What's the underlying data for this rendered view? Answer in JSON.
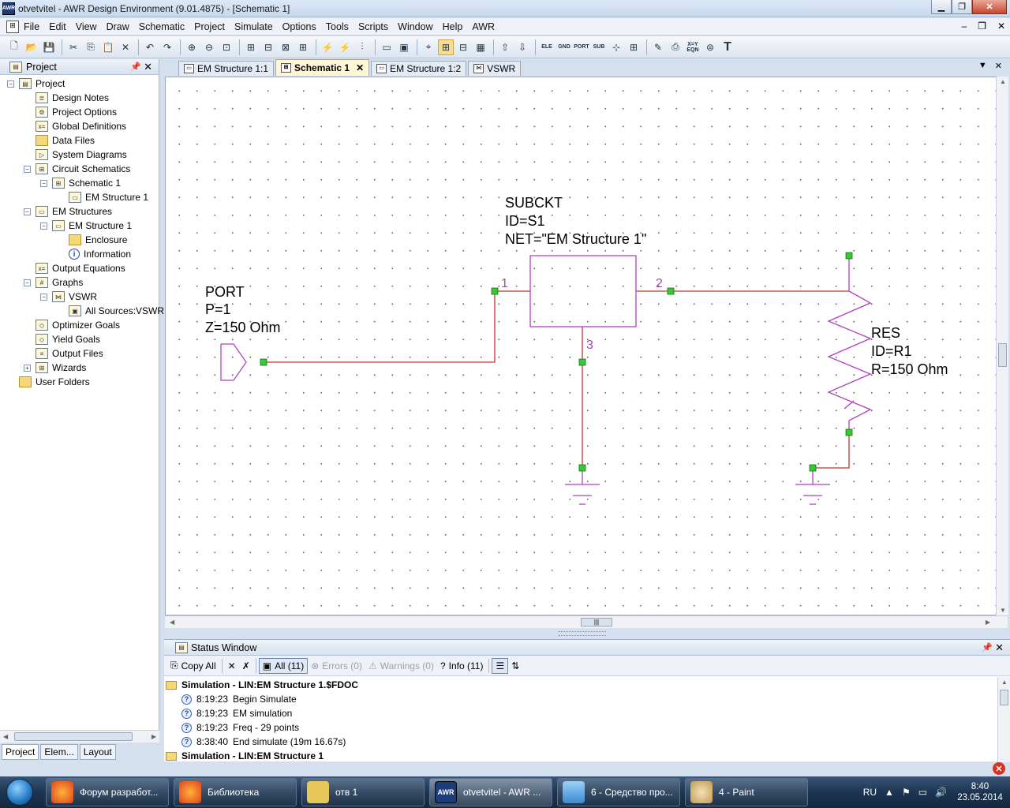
{
  "window": {
    "title": "otvetvitel - AWR Design Environment (9.01.4875) - [Schematic 1]",
    "app_icon": "AWR"
  },
  "menu": [
    "File",
    "Edit",
    "View",
    "Draw",
    "Schematic",
    "Project",
    "Simulate",
    "Options",
    "Tools",
    "Scripts",
    "Window",
    "Help",
    "AWR"
  ],
  "toolbar": {
    "labels": {
      "ele": "ELE",
      "gnd": "GND",
      "port": "PORT",
      "sub": "SUB",
      "eqn": "X=Y\nEQN",
      "text": "T"
    }
  },
  "project_panel": {
    "title": "Project",
    "tree": [
      {
        "label": "Project",
        "icon": "project-icon"
      },
      {
        "label": "Design Notes",
        "icon": "notes-icon"
      },
      {
        "label": "Project Options",
        "icon": "options-icon"
      },
      {
        "label": "Global Definitions",
        "icon": "definitions-icon"
      },
      {
        "label": "Data Files",
        "icon": "folder-icon"
      },
      {
        "label": "System Diagrams",
        "icon": "system-diagram-icon"
      },
      {
        "label": "Circuit Schematics",
        "icon": "schematic-icon"
      },
      {
        "label": "Schematic 1",
        "icon": "schematic-icon"
      },
      {
        "label": "EM Structure 1",
        "icon": "em-structure-icon"
      },
      {
        "label": "EM Structures",
        "icon": "em-structure-icon"
      },
      {
        "label": "EM Structure 1",
        "icon": "em-structure-icon"
      },
      {
        "label": "Enclosure",
        "icon": "folder-icon"
      },
      {
        "label": "Information",
        "icon": "info-icon"
      },
      {
        "label": "Output Equations",
        "icon": "equations-icon"
      },
      {
        "label": "Graphs",
        "icon": "graphs-icon"
      },
      {
        "label": "VSWR",
        "icon": "graph-icon"
      },
      {
        "label": "All Sources:VSWR",
        "icon": "measurement-icon"
      },
      {
        "label": "Optimizer Goals",
        "icon": "goals-icon"
      },
      {
        "label": "Yield Goals",
        "icon": "goals-icon"
      },
      {
        "label": "Output Files",
        "icon": "output-files-icon"
      },
      {
        "label": "Wizards",
        "icon": "wizard-icon"
      },
      {
        "label": "User Folders",
        "icon": "folder-icon"
      }
    ],
    "bottom_tabs": [
      "Project",
      "Elem...",
      "Layout"
    ]
  },
  "doc_tabs": [
    {
      "label": "EM Structure 1:1",
      "active": false
    },
    {
      "label": "Schematic 1",
      "active": true
    },
    {
      "label": "EM Structure 1:2",
      "active": false
    },
    {
      "label": "VSWR",
      "active": false
    }
  ],
  "schematic": {
    "subckt": {
      "line1": "SUBCKT",
      "line2": "ID=S1",
      "line3": "NET=\"EM Structure 1\""
    },
    "port": {
      "line1": "PORT",
      "line2": "P=1",
      "line3": "Z=150 Ohm"
    },
    "res": {
      "line1": "RES",
      "line2": "ID=R1",
      "line3": "R=150 Ohm"
    },
    "pins": {
      "p1": "1",
      "p2": "2",
      "p3": "3"
    },
    "colors": {
      "wire": "#c0392b",
      "component": "#b03fbf",
      "node": "#33cc33"
    }
  },
  "status_window": {
    "title": "Status Window",
    "buttons": {
      "copy_all": "Copy All",
      "all": "All (11)",
      "errors": "Errors (0)",
      "warnings": "Warnings (0)",
      "info": "Info (11)"
    },
    "entries": [
      {
        "type": "group",
        "text": "Simulation  - LIN:EM Structure 1.$FDOC"
      },
      {
        "type": "info",
        "time": "8:19:23",
        "text": "Begin Simulate"
      },
      {
        "type": "info",
        "time": "8:19:23",
        "text": "EM simulation"
      },
      {
        "type": "info",
        "time": "8:19:23",
        "text": "Freq - 29 points"
      },
      {
        "type": "info",
        "time": "8:38:40",
        "text": "End simulate (19m 16.67s)"
      },
      {
        "type": "group",
        "text": "Simulation  - LIN:EM Structure 1"
      }
    ]
  },
  "taskbar": {
    "tasks": [
      {
        "label": "Форум разработ...",
        "icon": "firefox-icon"
      },
      {
        "label": "Библиотека",
        "icon": "firefox-icon"
      },
      {
        "label": "отв 1",
        "icon": "folder-icon"
      },
      {
        "label": "otvetvitel - AWR ...",
        "icon": "awr-icon",
        "active": true
      },
      {
        "label": "6 - Средство про...",
        "icon": "snipping-tool-icon"
      },
      {
        "label": "4 - Paint",
        "icon": "paint-icon"
      }
    ],
    "lang": "RU",
    "time": "8:40",
    "date": "23.05.2014"
  }
}
